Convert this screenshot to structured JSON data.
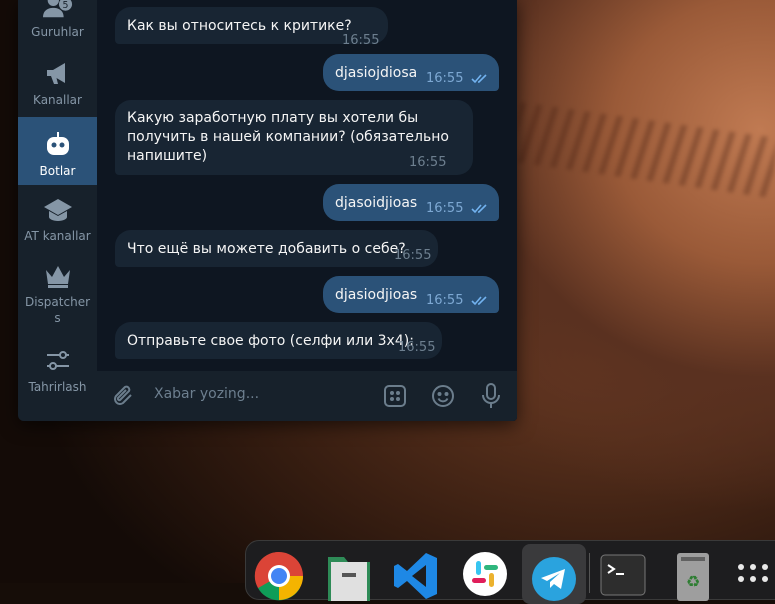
{
  "sidebar": {
    "items": [
      {
        "label": "Guruhlar",
        "icon": "group-icon",
        "badge": "5"
      },
      {
        "label": "Kanallar",
        "icon": "megaphone-icon"
      },
      {
        "label": "Botlar",
        "icon": "robot-icon",
        "active": true
      },
      {
        "label": "AT kanallar",
        "icon": "graduation-cap-icon"
      },
      {
        "label": "Dispatcher",
        "label2": "s",
        "icon": "crown-icon"
      },
      {
        "label": "Tahrirlash",
        "icon": "sliders-icon"
      }
    ]
  },
  "messages": [
    {
      "dir": "in",
      "text": "Как вы относитесь к критике?",
      "time": "16:55"
    },
    {
      "dir": "out",
      "text": "djasiojdiosa",
      "time": "16:55"
    },
    {
      "dir": "in",
      "lines": [
        "Какую заработную плату вы хотели бы",
        "получить в нашей компании? (обязательно",
        "напишите)"
      ],
      "time": "16:55"
    },
    {
      "dir": "out",
      "text": "djasoidjioas",
      "time": "16:55"
    },
    {
      "dir": "in",
      "text": "Что ещё вы можете добавить о себе?",
      "time": "16:55"
    },
    {
      "dir": "out",
      "text": "djasiodjioas",
      "time": "16:55"
    },
    {
      "dir": "in",
      "text": "Отправьте свое фото (селфи или 3x4):",
      "time": "16:55"
    }
  ],
  "composer": {
    "placeholder": "Xabar yozing..."
  },
  "dock": {
    "apps": [
      "chrome-icon",
      "files-icon",
      "vscode-icon",
      "slack-icon",
      "telegram-icon",
      "terminal-icon",
      "trash-icon",
      "app-grid-icon"
    ]
  },
  "colors": {
    "window_bg": "#0e1621",
    "sidebar_bg": "#17212b",
    "incoming_bubble": "#182533",
    "outgoing_bubble": "#2b5278",
    "active_folder": "#2b5278",
    "read_checks": "#72b2ef"
  }
}
